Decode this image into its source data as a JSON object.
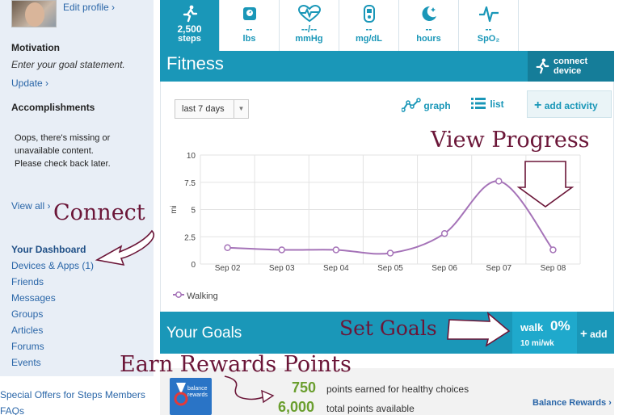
{
  "sidebar": {
    "edit_profile": "Edit profile ›",
    "motivation_heading": "Motivation",
    "motivation_text": "Enter your goal statement.",
    "update_link": "Update ›",
    "accomplishments_heading": "Accomplishments",
    "missing_line1": "Oops, there's missing or",
    "missing_line2": "unavailable content.",
    "missing_line3": "Please check back later.",
    "view_all": "View all ›",
    "nav": [
      "Your Dashboard",
      "Devices & Apps (1)",
      "Friends",
      "Messages",
      "Groups",
      "Articles",
      "Forums",
      "Events"
    ],
    "special_offers": "Special Offers for Steps Members",
    "faqs": "FAQs"
  },
  "tabs": [
    {
      "value": "2,500",
      "unit": "steps",
      "icon": "runner-icon"
    },
    {
      "value": "--",
      "unit": "lbs",
      "icon": "scale-icon"
    },
    {
      "value": "--/--",
      "unit": "mmHg",
      "icon": "heart-pulse-icon"
    },
    {
      "value": "--",
      "unit": "mg/dL",
      "icon": "glucose-meter-icon"
    },
    {
      "value": "--",
      "unit": "hours",
      "icon": "moon-icon"
    },
    {
      "value": "--",
      "unit": "SpO₂",
      "icon": "pulse-icon"
    }
  ],
  "fitness": {
    "title": "Fitness",
    "connect_line1": "connect",
    "connect_line2": "device",
    "range": "last 7 days",
    "graph_label": "graph",
    "list_label": "list",
    "add_activity": "add activity",
    "legend_walking": "Walking"
  },
  "chart_data": {
    "type": "line",
    "x": [
      "Sep 02",
      "Sep 03",
      "Sep 04",
      "Sep 05",
      "Sep 06",
      "Sep 07",
      "Sep 08"
    ],
    "series": [
      {
        "name": "Walking",
        "values": [
          1.5,
          1.3,
          1.3,
          1.0,
          2.8,
          7.6,
          1.3
        ]
      }
    ],
    "ylabel": "mi",
    "yticks": [
      0,
      2.5,
      5,
      7.5,
      10
    ],
    "ylim": [
      0,
      10
    ],
    "grid": true,
    "color": "#a573b8"
  },
  "goals": {
    "title": "Your Goals",
    "walk_label": "walk",
    "walk_percent": "0%",
    "walk_target": "10 mi/wk",
    "add_label": "add"
  },
  "rewards": {
    "logo_line1": "balance",
    "logo_line2": "rewards",
    "points_earned": "750",
    "points_earned_label": "points earned for healthy choices",
    "points_total": "6,000",
    "points_total_label": "total points available",
    "balance_link": "Balance Rewards ›"
  },
  "annotations": {
    "connect": "Connect",
    "view_progress": "View Progress",
    "set_goals": "Set Goals",
    "earn_rewards": "Earn Rewards Points"
  },
  "colors": {
    "teal": "#1a97b8",
    "link": "#2a66a8",
    "annotation": "#6b1638",
    "points": "#6a9e2e"
  }
}
